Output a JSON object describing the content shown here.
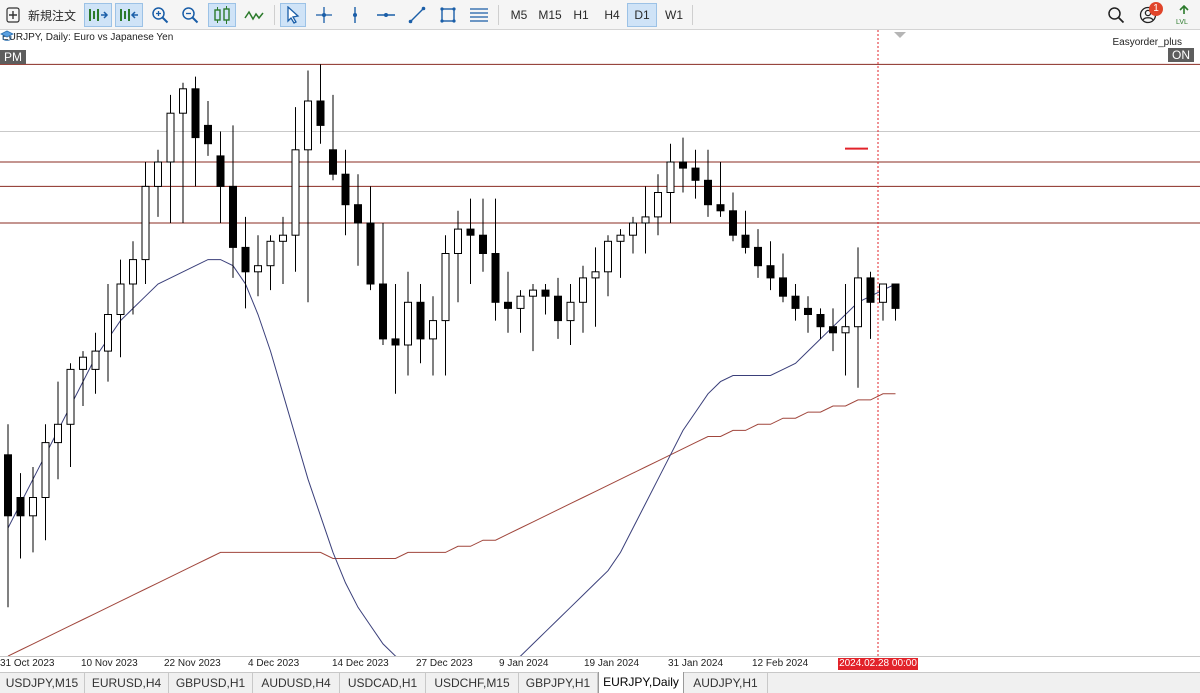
{
  "toolbar": {
    "new_order_label": "新規注文",
    "timeframes": [
      "M5",
      "M15",
      "H1",
      "H4",
      "D1",
      "W1"
    ],
    "active_timeframe": "D1",
    "notification_count": "1"
  },
  "chart": {
    "symbol_label": "EURJPY, Daily:",
    "symbol_desc": "Euro vs Japanese Yen",
    "left_box": "PM",
    "right_box": "ON",
    "ea_name": "Easyorder_plus",
    "cursor_time": "2024.02.28 00:00"
  },
  "axis": {
    "dates": [
      "31 Oct 2023",
      "10 Nov 2023",
      "22 Nov 2023",
      "4 Dec 2023",
      "14 Dec 2023",
      "27 Dec 2023",
      "9 Jan 2024",
      "19 Jan 2024",
      "31 Jan 2024",
      "12 Feb 2024"
    ]
  },
  "tabs": [
    "USDJPY,M15",
    "EURUSD,H4",
    "GBPUSD,H1",
    "AUDUSD,H4",
    "USDCAD,H1",
    "USDCHF,M15",
    "GBPJPY,H1",
    "EURJPY,Daily",
    "AUDJPY,H1"
  ],
  "active_tab": "EURJPY,Daily",
  "colors": {
    "bull": "#ffffff",
    "bear": "#000000",
    "ma_short": "#3a3f7a",
    "ma_long": "#a0463c",
    "level_line": "#8a2b22",
    "cursor": "#e2232a"
  },
  "chart_data": {
    "type": "candlestick",
    "candles": [
      {
        "o": 0.68,
        "h": 0.63,
        "l": 0.93,
        "c": 0.78
      },
      {
        "o": 0.75,
        "h": 0.71,
        "l": 0.85,
        "c": 0.78
      },
      {
        "o": 0.78,
        "h": 0.7,
        "l": 0.84,
        "c": 0.75
      },
      {
        "o": 0.75,
        "h": 0.63,
        "l": 0.82,
        "c": 0.66
      },
      {
        "o": 0.66,
        "h": 0.56,
        "l": 0.72,
        "c": 0.63
      },
      {
        "o": 0.63,
        "h": 0.53,
        "l": 0.7,
        "c": 0.54
      },
      {
        "o": 0.54,
        "h": 0.51,
        "l": 0.6,
        "c": 0.52
      },
      {
        "o": 0.54,
        "h": 0.48,
        "l": 0.58,
        "c": 0.51
      },
      {
        "o": 0.51,
        "h": 0.4,
        "l": 0.56,
        "c": 0.45
      },
      {
        "o": 0.45,
        "h": 0.36,
        "l": 0.52,
        "c": 0.4
      },
      {
        "o": 0.4,
        "h": 0.33,
        "l": 0.45,
        "c": 0.36
      },
      {
        "o": 0.36,
        "h": 0.2,
        "l": 0.4,
        "c": 0.24
      },
      {
        "o": 0.24,
        "h": 0.18,
        "l": 0.29,
        "c": 0.2
      },
      {
        "o": 0.2,
        "h": 0.09,
        "l": 0.3,
        "c": 0.12
      },
      {
        "o": 0.12,
        "h": 0.07,
        "l": 0.3,
        "c": 0.08
      },
      {
        "o": 0.08,
        "h": 0.06,
        "l": 0.24,
        "c": 0.16
      },
      {
        "o": 0.14,
        "h": 0.1,
        "l": 0.19,
        "c": 0.17
      },
      {
        "o": 0.19,
        "h": 0.15,
        "l": 0.3,
        "c": 0.24
      },
      {
        "o": 0.24,
        "h": 0.14,
        "l": 0.39,
        "c": 0.34
      },
      {
        "o": 0.34,
        "h": 0.29,
        "l": 0.44,
        "c": 0.38
      },
      {
        "o": 0.38,
        "h": 0.32,
        "l": 0.42,
        "c": 0.37
      },
      {
        "o": 0.37,
        "h": 0.32,
        "l": 0.41,
        "c": 0.33
      },
      {
        "o": 0.33,
        "h": 0.29,
        "l": 0.4,
        "c": 0.32
      },
      {
        "o": 0.32,
        "h": 0.11,
        "l": 0.38,
        "c": 0.18
      },
      {
        "o": 0.18,
        "h": 0.05,
        "l": 0.43,
        "c": 0.1
      },
      {
        "o": 0.1,
        "h": 0.04,
        "l": 0.17,
        "c": 0.14
      },
      {
        "o": 0.18,
        "h": 0.09,
        "l": 0.23,
        "c": 0.22
      },
      {
        "o": 0.22,
        "h": 0.18,
        "l": 0.32,
        "c": 0.27
      },
      {
        "o": 0.27,
        "h": 0.22,
        "l": 0.37,
        "c": 0.3
      },
      {
        "o": 0.3,
        "h": 0.24,
        "l": 0.41,
        "c": 0.4
      },
      {
        "o": 0.4,
        "h": 0.3,
        "l": 0.5,
        "c": 0.49
      },
      {
        "o": 0.49,
        "h": 0.4,
        "l": 0.58,
        "c": 0.5
      },
      {
        "o": 0.5,
        "h": 0.38,
        "l": 0.55,
        "c": 0.43
      },
      {
        "o": 0.43,
        "h": 0.4,
        "l": 0.53,
        "c": 0.49
      },
      {
        "o": 0.49,
        "h": 0.42,
        "l": 0.55,
        "c": 0.46
      },
      {
        "o": 0.46,
        "h": 0.32,
        "l": 0.55,
        "c": 0.35
      },
      {
        "o": 0.35,
        "h": 0.28,
        "l": 0.43,
        "c": 0.31
      },
      {
        "o": 0.31,
        "h": 0.26,
        "l": 0.4,
        "c": 0.32
      },
      {
        "o": 0.32,
        "h": 0.26,
        "l": 0.38,
        "c": 0.35
      },
      {
        "o": 0.35,
        "h": 0.26,
        "l": 0.46,
        "c": 0.43
      },
      {
        "o": 0.43,
        "h": 0.38,
        "l": 0.48,
        "c": 0.44
      },
      {
        "o": 0.44,
        "h": 0.41,
        "l": 0.48,
        "c": 0.42
      },
      {
        "o": 0.42,
        "h": 0.4,
        "l": 0.51,
        "c": 0.41
      },
      {
        "o": 0.41,
        "h": 0.4,
        "l": 0.45,
        "c": 0.42
      },
      {
        "o": 0.42,
        "h": 0.39,
        "l": 0.49,
        "c": 0.46
      },
      {
        "o": 0.46,
        "h": 0.4,
        "l": 0.5,
        "c": 0.43
      },
      {
        "o": 0.43,
        "h": 0.37,
        "l": 0.48,
        "c": 0.39
      },
      {
        "o": 0.39,
        "h": 0.34,
        "l": 0.47,
        "c": 0.38
      },
      {
        "o": 0.38,
        "h": 0.32,
        "l": 0.42,
        "c": 0.33
      },
      {
        "o": 0.33,
        "h": 0.31,
        "l": 0.39,
        "c": 0.32
      },
      {
        "o": 0.32,
        "h": 0.29,
        "l": 0.35,
        "c": 0.3
      },
      {
        "o": 0.3,
        "h": 0.24,
        "l": 0.35,
        "c": 0.29
      },
      {
        "o": 0.29,
        "h": 0.22,
        "l": 0.32,
        "c": 0.25
      },
      {
        "o": 0.25,
        "h": 0.17,
        "l": 0.3,
        "c": 0.2
      },
      {
        "o": 0.2,
        "h": 0.16,
        "l": 0.25,
        "c": 0.21
      },
      {
        "o": 0.21,
        "h": 0.18,
        "l": 0.26,
        "c": 0.23
      },
      {
        "o": 0.23,
        "h": 0.18,
        "l": 0.29,
        "c": 0.27
      },
      {
        "o": 0.27,
        "h": 0.2,
        "l": 0.29,
        "c": 0.28
      },
      {
        "o": 0.28,
        "h": 0.25,
        "l": 0.33,
        "c": 0.32
      },
      {
        "o": 0.32,
        "h": 0.28,
        "l": 0.35,
        "c": 0.34
      },
      {
        "o": 0.34,
        "h": 0.31,
        "l": 0.39,
        "c": 0.37
      },
      {
        "o": 0.37,
        "h": 0.33,
        "l": 0.41,
        "c": 0.39
      },
      {
        "o": 0.39,
        "h": 0.35,
        "l": 0.43,
        "c": 0.42
      },
      {
        "o": 0.42,
        "h": 0.4,
        "l": 0.46,
        "c": 0.44
      },
      {
        "o": 0.44,
        "h": 0.42,
        "l": 0.48,
        "c": 0.45
      },
      {
        "o": 0.45,
        "h": 0.44,
        "l": 0.49,
        "c": 0.47
      },
      {
        "o": 0.47,
        "h": 0.44,
        "l": 0.51,
        "c": 0.48
      },
      {
        "o": 0.48,
        "h": 0.4,
        "l": 0.55,
        "c": 0.47
      },
      {
        "o": 0.47,
        "h": 0.34,
        "l": 0.57,
        "c": 0.39
      },
      {
        "o": 0.39,
        "h": 0.38,
        "l": 0.49,
        "c": 0.43
      },
      {
        "o": 0.43,
        "h": 0.4,
        "l": 0.46,
        "c": 0.4
      },
      {
        "o": 0.4,
        "h": 0.41,
        "l": 0.46,
        "c": 0.44
      }
    ],
    "ma_short": [
      0.8,
      0.76,
      0.72,
      0.68,
      0.64,
      0.6,
      0.56,
      0.52,
      0.49,
      0.46,
      0.44,
      0.42,
      0.4,
      0.39,
      0.38,
      0.37,
      0.36,
      0.36,
      0.37,
      0.4,
      0.45,
      0.51,
      0.58,
      0.65,
      0.72,
      0.78,
      0.84,
      0.89,
      0.93,
      0.96,
      0.99,
      1.01,
      1.02,
      1.03,
      1.03,
      1.04,
      1.04,
      1.04,
      1.03,
      1.03,
      1.02,
      1.01,
      0.99,
      0.97,
      0.95,
      0.93,
      0.91,
      0.89,
      0.87,
      0.84,
      0.8,
      0.76,
      0.72,
      0.68,
      0.64,
      0.61,
      0.58,
      0.56,
      0.55,
      0.55,
      0.55,
      0.55,
      0.54,
      0.53,
      0.51,
      0.49,
      0.47,
      0.45,
      0.43,
      0.42,
      0.41,
      0.4
    ],
    "ma_long": [
      1.01,
      1.0,
      0.99,
      0.98,
      0.97,
      0.96,
      0.95,
      0.94,
      0.93,
      0.92,
      0.91,
      0.9,
      0.89,
      0.88,
      0.87,
      0.86,
      0.85,
      0.84,
      0.84,
      0.84,
      0.84,
      0.84,
      0.84,
      0.84,
      0.84,
      0.84,
      0.85,
      0.85,
      0.85,
      0.85,
      0.85,
      0.85,
      0.84,
      0.84,
      0.84,
      0.84,
      0.83,
      0.83,
      0.82,
      0.82,
      0.81,
      0.8,
      0.79,
      0.78,
      0.77,
      0.76,
      0.75,
      0.74,
      0.73,
      0.72,
      0.71,
      0.7,
      0.69,
      0.68,
      0.67,
      0.66,
      0.65,
      0.65,
      0.64,
      0.64,
      0.63,
      0.63,
      0.62,
      0.62,
      0.61,
      0.61,
      0.6,
      0.6,
      0.59,
      0.59,
      0.58,
      0.58
    ],
    "levels": [
      0.04,
      0.2,
      0.24,
      0.3
    ],
    "price_scale": "normalized 0 (top) – 1 (bottom), no price labels shown"
  }
}
